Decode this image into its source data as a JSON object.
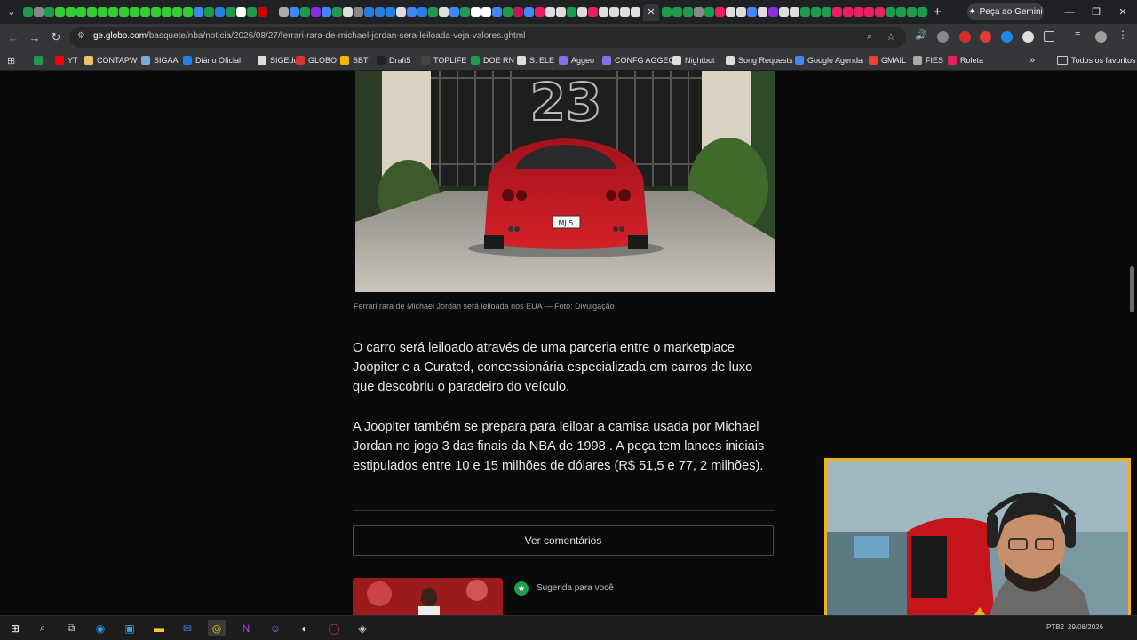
{
  "browser": {
    "gemini_button_label": "Peça ao Gemini",
    "url_host": "ge.globo.com",
    "url_path": "/basquete/nba/noticia/2026/08/27/ferrari-rara-de-michael-jordan-sera-leiloada-veja-valores.ghtml",
    "tab_favicon_colors": [
      "#1e9c4e",
      "#888",
      "#1e9c4e",
      "#32cd32",
      "#32cd32",
      "#32cd32",
      "#32cd32",
      "#32cd32",
      "#32cd32",
      "#32cd32",
      "#32cd32",
      "#32cd32",
      "#32cd32",
      "#32cd32",
      "#32cd32",
      "#32cd32",
      "#4285f4",
      "#1e9c4e",
      "#2a7de1",
      "#1e9c4e",
      "#ffffff",
      "#1e9c4e",
      "#c00",
      "#222",
      "#aaa",
      "#4285f4",
      "#1e9c4e",
      "#8a2be2",
      "#4285f4",
      "#1e9c4e",
      "#ddd",
      "#888",
      "#2a7de1",
      "#2a7de1",
      "#2a7de1",
      "#ddd",
      "#4285f4",
      "#2a7de1",
      "#1e9c4e",
      "#ddd",
      "#4285f4",
      "#1e9c4e",
      "#ffffff",
      "#ffffff",
      "#4285f4",
      "#1e9c4e",
      "#c2185b",
      "#4285f4",
      "#e91e63",
      "#ddd",
      "#ddd",
      "#1e9c4e",
      "#ddd",
      "#e91e63",
      "#ddd",
      "#ddd",
      "#ddd",
      "#ddd"
    ],
    "tab_favicon_colors_right": [
      "#1e9c4e",
      "#1e9c4e",
      "#1e9c4e",
      "#888",
      "#1e9c4e",
      "#e91e63",
      "#ddd",
      "#ddd",
      "#4285f4",
      "#ddd",
      "#8a2be2",
      "#ddd",
      "#ddd",
      "#1e9c4e",
      "#1e9c4e",
      "#1e9c4e",
      "#e91e63",
      "#e91e63",
      "#e91e63",
      "#e91e63",
      "#e91e63",
      "#1e9c4e",
      "#1e9c4e",
      "#1e9c4e",
      "#1e9c4e"
    ]
  },
  "bookmarks": [
    {
      "label": "",
      "icon": "green-square",
      "color": "#1e9c4e"
    },
    {
      "label": "YT",
      "icon": "youtube-icon",
      "color": "#ff0000"
    },
    {
      "label": "CONTAPW",
      "icon": "contapw-icon",
      "color": "#e9c46a"
    },
    {
      "label": "SIGAA",
      "icon": "sigaa-icon",
      "color": "#7aa9d6"
    },
    {
      "label": "Diário Oficial",
      "icon": "diario-icon",
      "color": "#2a7de1"
    },
    {
      "label": "SIGEduc",
      "icon": "sigeduc-icon",
      "color": "#ddd"
    },
    {
      "label": "GLOBO",
      "icon": "globo-icon",
      "color": "#d33"
    },
    {
      "label": "SBT",
      "icon": "sbt-icon",
      "color": "#f5b700"
    },
    {
      "label": "Draft5",
      "icon": "draft5-icon",
      "color": "#222"
    },
    {
      "label": "TOPLIFE",
      "icon": "toplife-icon",
      "color": "#444"
    },
    {
      "label": "DOE RN",
      "icon": "doe-icon",
      "color": "#1e9c4e"
    },
    {
      "label": "S. ELE",
      "icon": "anchor-icon",
      "color": "#ddd"
    },
    {
      "label": "Aggeo",
      "icon": "aggeo-icon",
      "color": "#8a6de9"
    },
    {
      "label": "CONFG AGGEO",
      "icon": "aggeo-config-icon",
      "color": "#8a6de9"
    },
    {
      "label": "Nightbot",
      "icon": "nightbot-icon",
      "color": "#ddd"
    },
    {
      "label": "Song Requests",
      "icon": "song-icon",
      "color": "#ddd"
    },
    {
      "label": "Google Agenda",
      "icon": "calendar-icon",
      "color": "#4285f4"
    },
    {
      "label": "GMAIL",
      "icon": "gmail-icon",
      "color": "#ea4335"
    },
    {
      "label": "FIES",
      "icon": "fies-icon",
      "color": "#aaa"
    },
    {
      "label": "Roleta",
      "icon": "roleta-icon",
      "color": "#e91e63"
    }
  ],
  "bookmarks_more": "»",
  "all_favorites_label": "Todos os favoritos",
  "article": {
    "photo_plate": "MJ 5",
    "photo_gate_number": "23",
    "caption": "Ferrari rara de Michael Jordan será leiloada nos EUA — Foto: Divulgação",
    "paragraphs": [
      "O carro será leiloado através de uma parceria entre o marketplace Joopiter e a Curated, concessionária especializada em carros de luxo que descobriu o paradeiro do veículo.",
      "A Joopiter também se prepara para leiloar a camisa usada por Michael Jordan no jogo 3 das finais da NBA de 1998 . A peça tem lances iniciais estipulados entre 10 e 15 milhões de dólares (R$ 51,5 e 77, 2 milhões)."
    ],
    "comments_button": "Ver comentários",
    "suggested_label": "Sugerida para você"
  },
  "taskbar": {
    "tray_lang": "PTB2",
    "tray_date": "29/08/2026"
  },
  "colors": {
    "webcam_border": "#f2b01e",
    "suggested_icon": "#1e9c4e"
  }
}
